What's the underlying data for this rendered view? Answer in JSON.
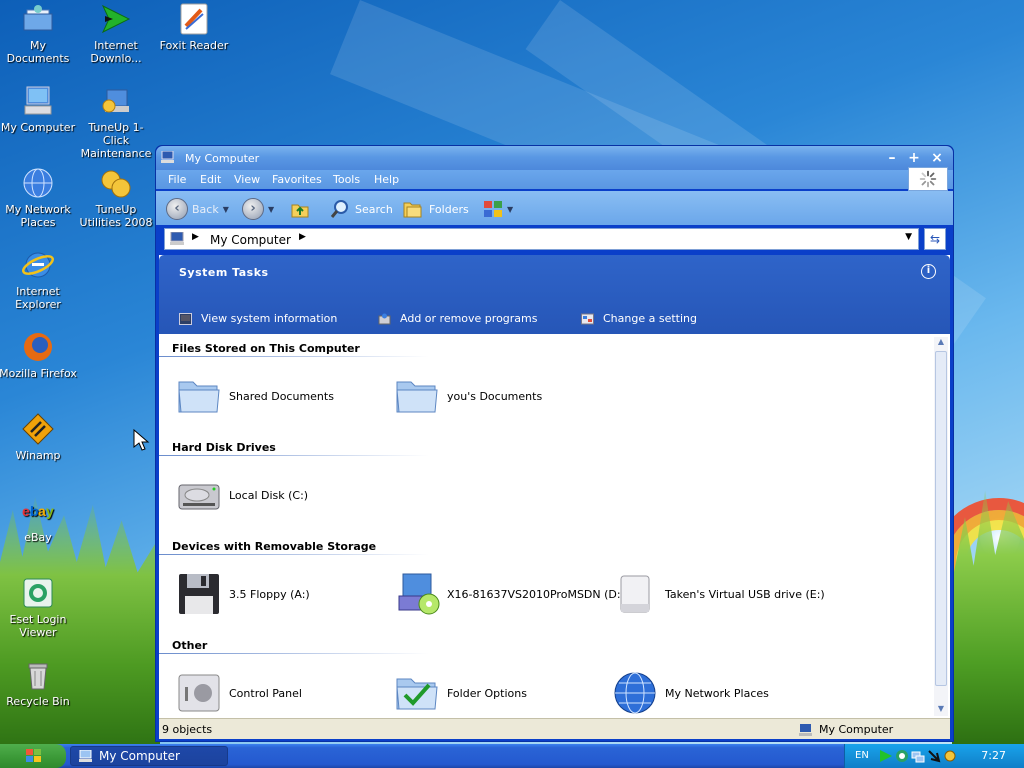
{
  "desktop": {
    "icons": [
      {
        "label": "My Documents",
        "icon": "my-documents-icon"
      },
      {
        "label": "Internet Downlo...",
        "icon": "internet-download-manager-icon"
      },
      {
        "label": "Foxit Reader",
        "icon": "foxit-reader-icon"
      },
      {
        "label": "My Computer",
        "icon": "my-computer-icon"
      },
      {
        "label": "TuneUp 1-Click Maintenance",
        "icon": "tuneup-1-click-icon"
      },
      {
        "label": "My Network Places",
        "icon": "my-network-places-icon"
      },
      {
        "label": "TuneUp Utilities 2008",
        "icon": "tuneup-utilities-icon"
      },
      {
        "label": "Internet Explorer",
        "icon": "internet-explorer-icon"
      },
      {
        "label": "Mozilla Firefox",
        "icon": "firefox-icon"
      },
      {
        "label": "Winamp",
        "icon": "winamp-icon"
      },
      {
        "label": "eBay",
        "icon": "ebay-icon"
      },
      {
        "label": "Eset Login Viewer",
        "icon": "eset-login-viewer-icon"
      },
      {
        "label": "Recycle Bin",
        "icon": "recycle-bin-icon"
      }
    ]
  },
  "window": {
    "title": "My Computer",
    "menu": [
      "File",
      "Edit",
      "View",
      "Favorites",
      "Tools",
      "Help"
    ],
    "toolbar": {
      "back": "Back",
      "search": "Search",
      "folders": "Folders"
    },
    "address": "My Computer",
    "system_tasks": {
      "title": "System Tasks",
      "items": [
        "View system information",
        "Add or remove programs",
        "Change a setting"
      ]
    },
    "sections": [
      {
        "title": "Files Stored on This Computer",
        "items": [
          "Shared Documents",
          "you's Documents"
        ]
      },
      {
        "title": "Hard Disk Drives",
        "items": [
          "Local Disk (C:)"
        ]
      },
      {
        "title": "Devices with Removable Storage",
        "items": [
          "3.5 Floppy (A:)",
          "X16-81637VS2010ProMSDN (D:)",
          "Taken's Virtual USB drive (E:)"
        ]
      },
      {
        "title": "Other",
        "items": [
          "Control Panel",
          "Folder Options",
          "My Network Places"
        ]
      }
    ],
    "status": {
      "objects": "9 objects",
      "location": "My Computer"
    }
  },
  "taskbar": {
    "task_button": "My Computer",
    "language": "EN",
    "clock": "7:27"
  },
  "colors": {
    "title_blue": "#5a98e4",
    "tasks_blue": "#2656b7",
    "taskbar_blue": "#2459cf",
    "start_green": "#3c9a38"
  }
}
